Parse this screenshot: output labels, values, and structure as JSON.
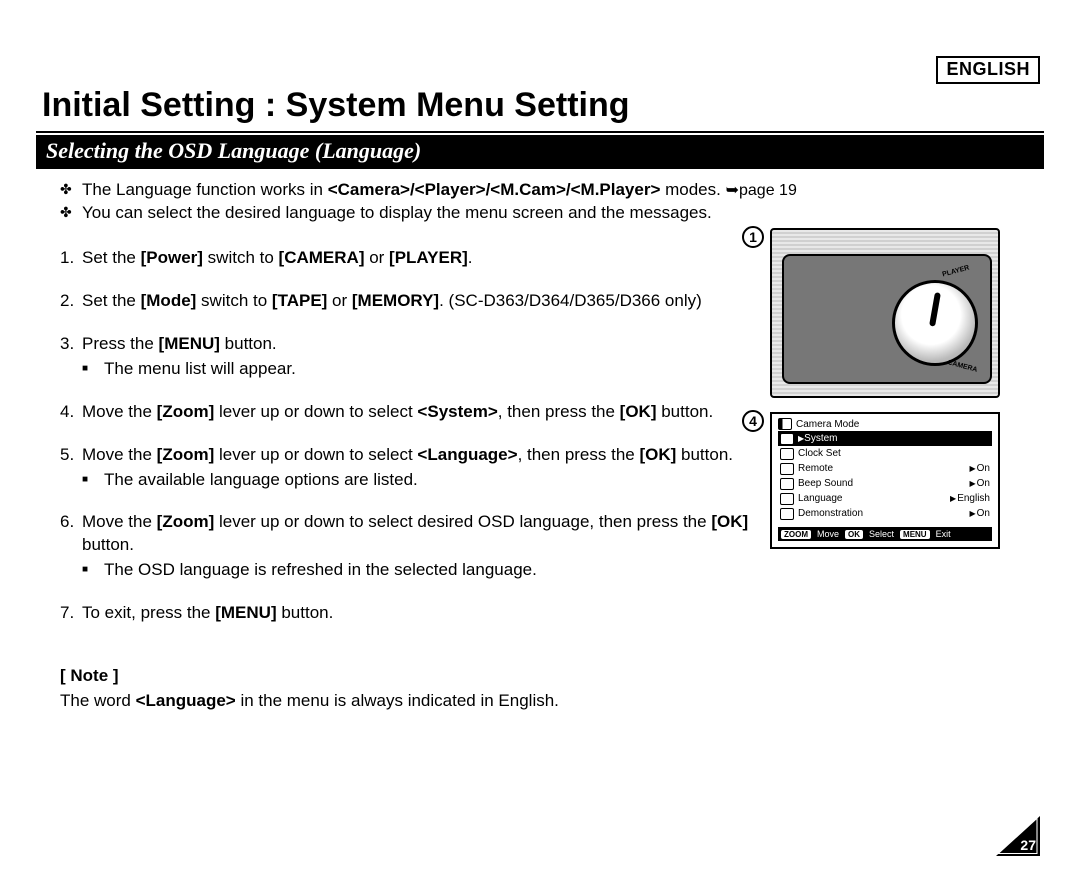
{
  "language_tag": "ENGLISH",
  "title": "Initial Setting : System Menu Setting",
  "section_heading": "Selecting the OSD Language (Language)",
  "intro": {
    "b1_pre": "The Language function works in ",
    "b1_bold": "<Camera>/<Player>/<M.Cam>/<M.Player>",
    "b1_post": " modes. ",
    "b1_ref": "➥page 19",
    "b2": "You can select the desired language to display the menu screen and the messages."
  },
  "steps": {
    "s1_a": "Set the ",
    "s1_b": "[Power]",
    "s1_c": " switch to ",
    "s1_d": "[CAMERA]",
    "s1_e": " or ",
    "s1_f": "[PLAYER]",
    "s1_g": ".",
    "s2_a": "Set the ",
    "s2_b": "[Mode]",
    "s2_c": " switch to ",
    "s2_d": "[TAPE]",
    "s2_e": " or ",
    "s2_f": "[MEMORY]",
    "s2_g": ". (SC-D363/D364/D365/D366 only)",
    "s3_a": "Press the ",
    "s3_b": "[MENU]",
    "s3_c": " button.",
    "s3_sub": "The menu list will appear.",
    "s4_a": "Move the ",
    "s4_b": "[Zoom]",
    "s4_c": " lever up or down to select ",
    "s4_d": "<System>",
    "s4_e": ", then press the ",
    "s4_f": "[OK]",
    "s4_g": " button.",
    "s5_a": "Move the ",
    "s5_b": "[Zoom]",
    "s5_c": " lever up or down to select ",
    "s5_d": "<Language>",
    "s5_e": ", then press the ",
    "s5_f": "[OK]",
    "s5_g": " button.",
    "s5_sub": "The available language options are listed.",
    "s6_a": "Move the ",
    "s6_b": "[Zoom]",
    "s6_c": " lever up or down to select desired OSD language, then press the ",
    "s6_d": "[OK]",
    "s6_e": " button.",
    "s6_sub": "The OSD language is refreshed in the selected language.",
    "s7_a": "To exit, press the ",
    "s7_b": "[MENU]",
    "s7_c": " button."
  },
  "note": {
    "heading": "[ Note ]",
    "a": "The word ",
    "b": "<Language>",
    "c": " in the menu is always indicated in English."
  },
  "illus": {
    "badge1": "1",
    "badge4": "4",
    "dial_top": "PLAYER",
    "dial_bot": "CAMERA"
  },
  "osd": {
    "title": "Camera Mode",
    "rows": [
      {
        "label": "System",
        "value": "",
        "selected": true
      },
      {
        "label": "Clock Set",
        "value": "",
        "selected": false
      },
      {
        "label": "Remote",
        "value": "On",
        "selected": false
      },
      {
        "label": "Beep Sound",
        "value": "On",
        "selected": false
      },
      {
        "label": "Language",
        "value": "English",
        "selected": false
      },
      {
        "label": "Demonstration",
        "value": "On",
        "selected": false
      }
    ],
    "footer": {
      "zoom_tag": "ZOOM",
      "zoom_lbl": "Move",
      "ok_tag": "OK",
      "ok_lbl": "Select",
      "menu_tag": "MENU",
      "menu_lbl": "Exit"
    }
  },
  "page_number": "27"
}
